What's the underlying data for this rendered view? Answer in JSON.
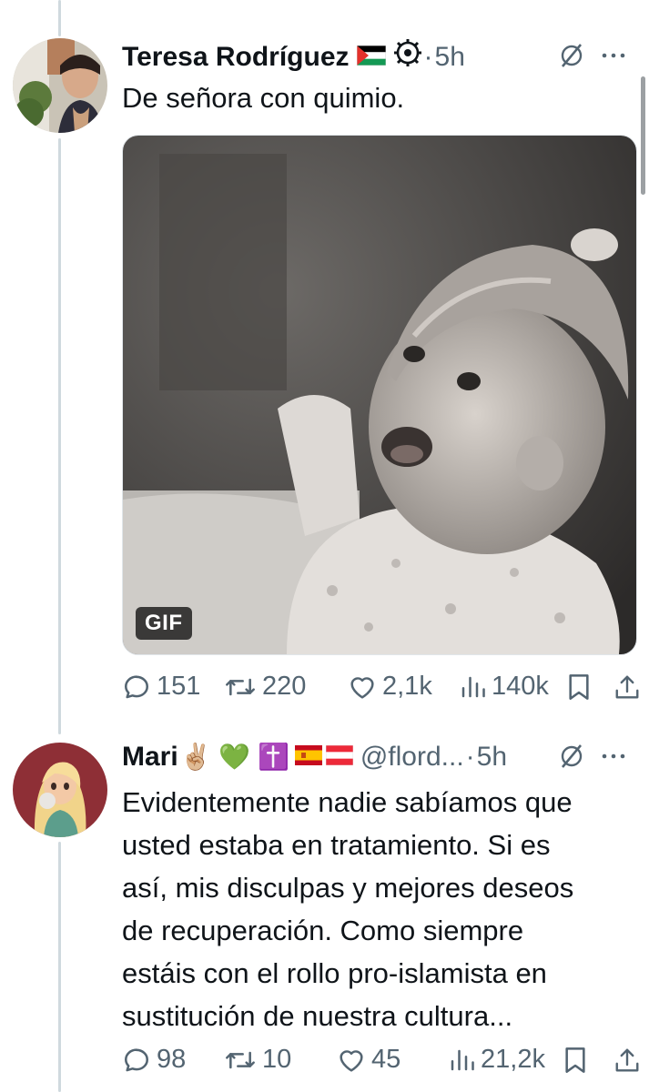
{
  "tweets": [
    {
      "display_name": "Teresa Rodríguez",
      "handle": "",
      "time": "5h",
      "text": "De señora con quimio.",
      "media": {
        "badge": "GIF"
      },
      "metrics": {
        "replies": "151",
        "retweets": "220",
        "likes": "2,1k",
        "views": "140k"
      },
      "badges": [
        "palestine-flag",
        "verified-gear-icon"
      ]
    },
    {
      "display_name": "Mari",
      "handle": "@flord...",
      "time": "5h",
      "emojis": "✌🏼 💚 ✝️",
      "text": "Evidentemente nadie sabíamos que\nusted estaba en tratamiento. Si es\nasí, mis disculpas y mejores deseos\nde recuperación. Como siempre\nestáis con el rollo pro-islamista en\nsustitución de nuestra cultura...",
      "metrics": {
        "replies": "98",
        "retweets": "10",
        "likes": "45",
        "views": "21,2k"
      },
      "badges": [
        "spain-flag",
        "austria-flag"
      ]
    }
  ],
  "colors": {
    "text": "#0f1419",
    "muted": "#536471",
    "thread_line": "#cfd9de"
  }
}
